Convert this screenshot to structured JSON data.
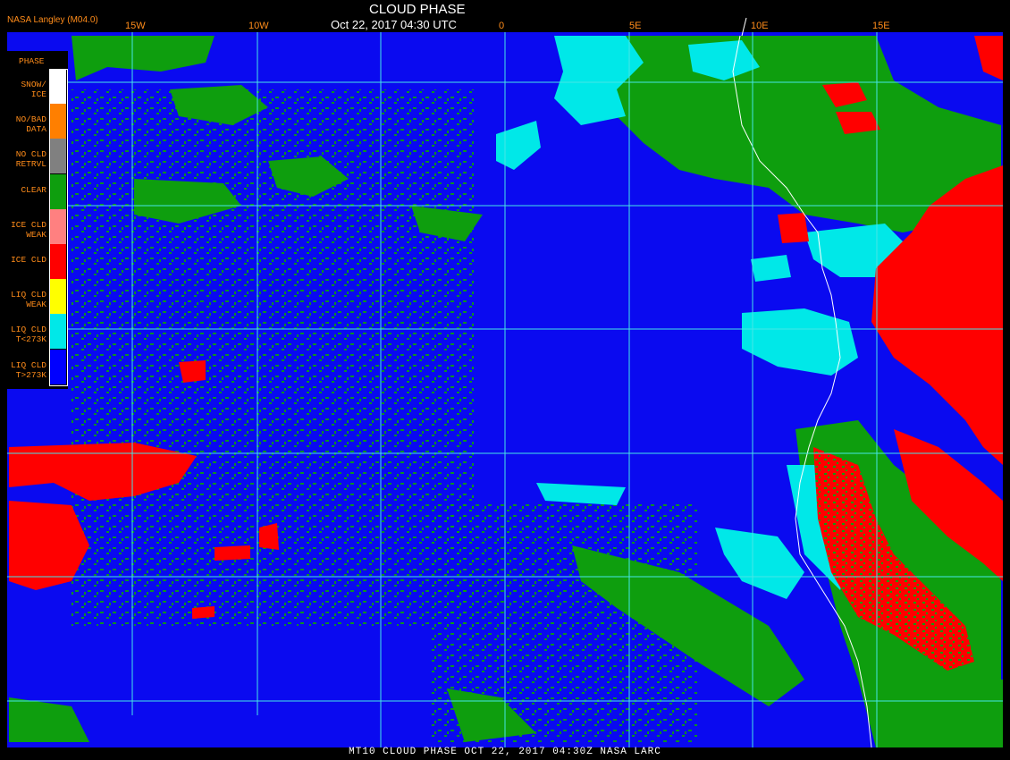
{
  "header": {
    "title": "CLOUD PHASE",
    "timestamp": "Oct 22, 2017 04:30 UTC",
    "credit": "NASA Langley (M04.0)"
  },
  "longitude_labels": [
    "15W",
    "10W",
    "0",
    "5E",
    "10E",
    "15E"
  ],
  "legend": {
    "title": "PHASE",
    "items": [
      {
        "label1": "SNOW/",
        "label2": "ICE",
        "color": "#ffffff"
      },
      {
        "label1": "NO/BAD",
        "label2": "DATA",
        "color": "#ff7f00"
      },
      {
        "label1": "NO CLD",
        "label2": "RETRVL",
        "color": "#808080"
      },
      {
        "label1": "",
        "label2": "CLEAR",
        "color": "#0e9e0e"
      },
      {
        "label1": "ICE CLD",
        "label2": "WEAK",
        "color": "#ff8080"
      },
      {
        "label1": "",
        "label2": "ICE CLD",
        "color": "#ff0000"
      },
      {
        "label1": "LIQ CLD",
        "label2": "WEAK",
        "color": "#ffff00"
      },
      {
        "label1": "LIQ CLD",
        "label2": "T<273K",
        "color": "#00e8e8"
      },
      {
        "label1": "LIQ CLD",
        "label2": "T>273K",
        "color": "#0000ff"
      }
    ]
  },
  "footer": "MT10  CLOUD PHASE   OCT 22, 2017 04:30Z   NASA LARC",
  "colors": {
    "ocean_liquid": "#0a0af0",
    "clear": "#0e9e0e",
    "ice": "#ff0000",
    "liq_cold": "#00e8e8",
    "grid": "#46e6e6",
    "coast": "#ffffff"
  }
}
